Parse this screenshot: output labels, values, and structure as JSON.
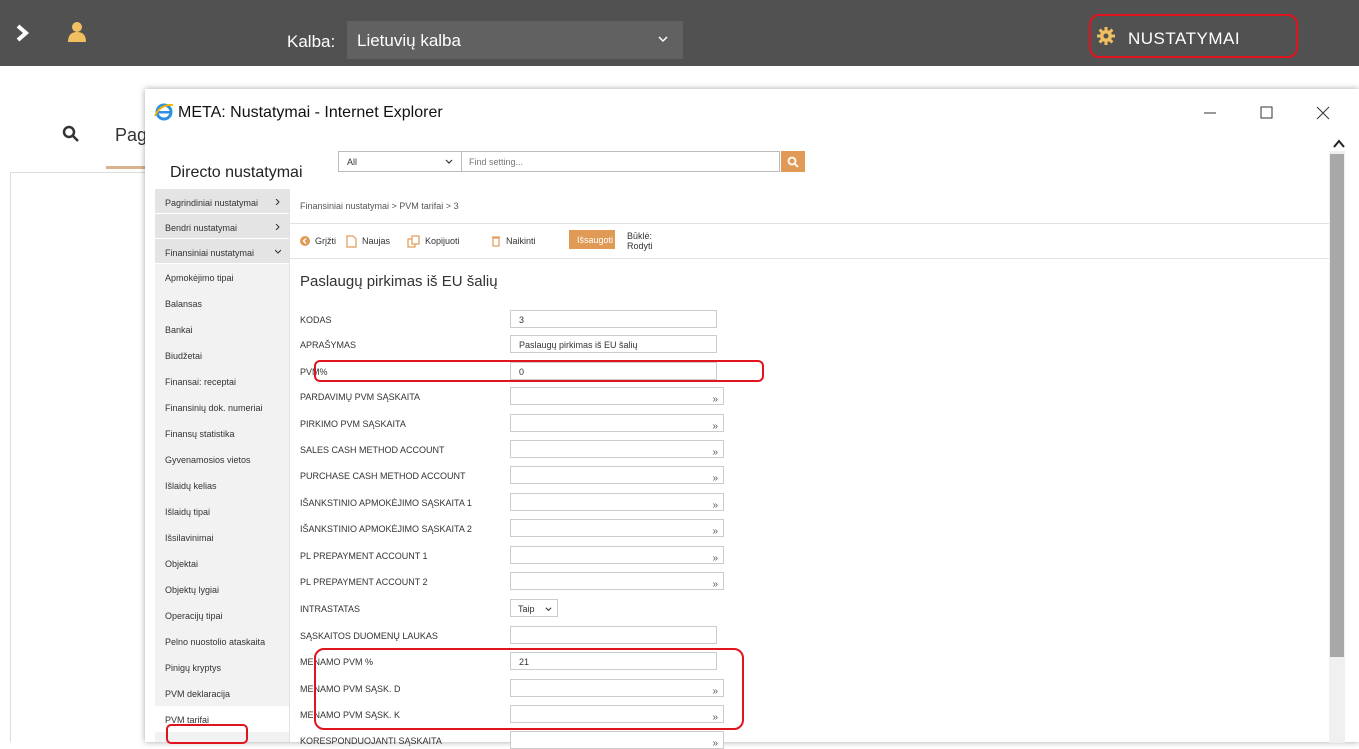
{
  "topbar": {
    "language_label": "Kalba:",
    "language_value": "Lietuvių kalba",
    "settings_label": "NUSTATYMAI"
  },
  "background": {
    "page_tab_label": "Pag"
  },
  "window": {
    "title": "META: Nustatymai - Internet Explorer",
    "heading": "Directo nustatymai",
    "filter_value": "All",
    "search_placeholder": "Find setting..."
  },
  "sidebar": {
    "groups": [
      {
        "label": "Pagrindiniai nustatymai",
        "arrow": ">"
      },
      {
        "label": "Bendri nustatymai",
        "arrow": ">"
      },
      {
        "label": "Finansiniai nustatymai",
        "arrow": "v"
      }
    ],
    "items": [
      "Apmokėjimo tipai",
      "Balansas",
      "Bankai",
      "Biudžetai",
      "Finansai: receptai",
      "Finansinių dok. numeriai",
      "Finansų statistika",
      "Gyvenamosios vietos",
      "Išlaidų kelias",
      "Išlaidų tipai",
      "Išsilavinimai",
      "Objektai",
      "Objektų lygiai",
      "Operacijų tipai",
      "Pelno nuostolio ataskaita",
      "Pinigų kryptys",
      "PVM deklaracija",
      "PVM tarifai"
    ]
  },
  "content": {
    "breadcrumb": "Finansiniai nustatymai > PVM tarifai > 3",
    "toolbar": {
      "back": "Grįžti",
      "new": "Naujas",
      "copy": "Kopijuoti",
      "delete": "Naikinti",
      "save": "Išsaugoti",
      "state": "Būklė: Rodyti"
    },
    "record_title": "Paslaugų pirkimas iš EU šalių",
    "fields": [
      {
        "label": "KODAS",
        "value": "3",
        "kind": "text"
      },
      {
        "label": "APRAŠYMAS",
        "value": "Paslaugų pirkimas iš EU šalių",
        "kind": "text"
      },
      {
        "label": "PVM%",
        "value": "0",
        "kind": "text"
      },
      {
        "label": "PARDAVIMŲ PVM SĄSKAITA",
        "value": "",
        "kind": "lookup"
      },
      {
        "label": "PIRKIMO PVM SĄSKAITA",
        "value": "",
        "kind": "lookup"
      },
      {
        "label": "SALES CASH METHOD ACCOUNT",
        "value": "",
        "kind": "lookup"
      },
      {
        "label": "PURCHASE CASH METHOD ACCOUNT",
        "value": "",
        "kind": "lookup"
      },
      {
        "label": "IŠANKSTINIO APMOKĖJIMO SĄSKAITA 1",
        "value": "",
        "kind": "lookup"
      },
      {
        "label": "IŠANKSTINIO APMOKĖJIMO SĄSKAITA 2",
        "value": "",
        "kind": "lookup"
      },
      {
        "label": "PL PREPAYMENT ACCOUNT 1",
        "value": "",
        "kind": "lookup"
      },
      {
        "label": "PL PREPAYMENT ACCOUNT 2",
        "value": "",
        "kind": "lookup"
      },
      {
        "label": "INTRASTATAS",
        "value": "Taip",
        "kind": "select"
      },
      {
        "label": "SĄSKAITOS DUOMENŲ LAUKAS",
        "value": "",
        "kind": "text"
      },
      {
        "label": "MENAMO PVM %",
        "value": "21",
        "kind": "text"
      },
      {
        "label": "MENAMO PVM SĄSK. D",
        "value": "",
        "kind": "lookup"
      },
      {
        "label": "MENAMO PVM SĄSK. K",
        "value": "",
        "kind": "lookup"
      },
      {
        "label": "KORESPONDUOJANTI SĄSKAITA",
        "value": "",
        "kind": "lookup"
      }
    ],
    "lookup_glyph": "»"
  },
  "colors": {
    "topbar": "#515151",
    "accent": "#e09a55",
    "highlight": "#e0141e"
  }
}
